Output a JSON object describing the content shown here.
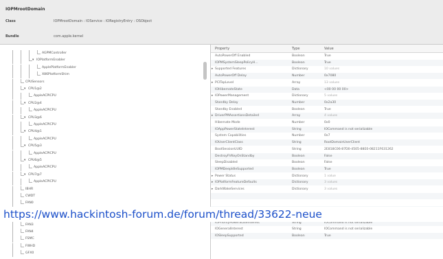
{
  "header": {
    "title": "IOPMrootDomain",
    "class_label": "Class",
    "class_value": "IOPMrootDomain : IOService : IORegistryEntry : OSObject",
    "bundle_label": "Bundle",
    "bundle_value": "com.apple.kernel"
  },
  "tree": {
    "rows": [
      {
        "label": "AGPMController",
        "indent": 4
      },
      {
        "label": "IOPlatformEnabler",
        "indent": 3,
        "expanded": true
      },
      {
        "label": "ApplePlatformEnabler",
        "indent": 4
      },
      {
        "label": "X86PlatformShim",
        "indent": 4
      },
      {
        "label": "CPUSensors",
        "indent": 2
      },
      {
        "label": "CPU1@2",
        "indent": 2,
        "expanded": true
      },
      {
        "label": "AppleACPICPU",
        "indent": 3
      },
      {
        "label": "CPU2@4",
        "indent": 2,
        "expanded": true
      },
      {
        "label": "AppleACPICPU",
        "indent": 3
      },
      {
        "label": "CPU3@6",
        "indent": 2,
        "expanded": true
      },
      {
        "label": "AppleACPICPU",
        "indent": 3
      },
      {
        "label": "CPU4@1",
        "indent": 2,
        "expanded": true
      },
      {
        "label": "AppleACPICPU",
        "indent": 3
      },
      {
        "label": "CPU5@3",
        "indent": 2,
        "expanded": true
      },
      {
        "label": "AppleACPICPU",
        "indent": 3
      },
      {
        "label": "CPU6@5",
        "indent": 2,
        "expanded": true
      },
      {
        "label": "AppleACPICPU",
        "indent": 3
      },
      {
        "label": "CPU7@7",
        "indent": 2,
        "expanded": true
      },
      {
        "label": "AppleACPICPU",
        "indent": 3
      },
      {
        "label": "IBHR",
        "indent": 2
      },
      {
        "label": "CWDT",
        "indent": 2
      },
      {
        "label": "FAN0",
        "indent": 2
      },
      {
        "label": "FAN1",
        "indent": 2
      },
      {
        "label": "FAN2",
        "indent": 2
      },
      {
        "label": "FAN3",
        "indent": 2
      },
      {
        "label": "FAN4",
        "indent": 2
      },
      {
        "label": "FSMC",
        "indent": 2
      },
      {
        "label": "FWHD",
        "indent": 2
      },
      {
        "label": "GFX0",
        "indent": 2
      }
    ]
  },
  "props": {
    "columns": [
      "Property",
      "Type",
      "Value"
    ],
    "rows": [
      {
        "key": "AutoPowerOff Enabled",
        "type": "Boolean",
        "value": "True"
      },
      {
        "key": "IOPMSystemSleepPolicyH...",
        "type": "Boolean",
        "value": "True"
      },
      {
        "key": "Supported Features",
        "type": "Dictionary",
        "value": "10 values",
        "expandable": true,
        "muted": true
      },
      {
        "key": "AutoPowerOff Delay",
        "type": "Number",
        "value": "0x7080"
      },
      {
        "key": "PCITopLevel",
        "type": "Array",
        "value": "13 values",
        "expandable": true,
        "muted": true
      },
      {
        "key": "IOHibernateState",
        "type": "Data",
        "value": "<00 00 00 00>"
      },
      {
        "key": "IOPowerManagement",
        "type": "Dictionary",
        "value": "5 values",
        "expandable": true,
        "muted": true
      },
      {
        "key": "Standby Delay",
        "type": "Number",
        "value": "0x2a30"
      },
      {
        "key": "Standby Enabled",
        "type": "Boolean",
        "value": "True"
      },
      {
        "key": "DriverPMAssertionsDetailed",
        "type": "Array",
        "value": "4 values",
        "expandable": true,
        "muted": true
      },
      {
        "key": "Hibernate Mode",
        "type": "Number",
        "value": "0x0"
      },
      {
        "key": "IOAppPowerStateInterest",
        "type": "String",
        "value": "IOCommand is not serializable"
      },
      {
        "key": "System Capabilities",
        "type": "Number",
        "value": "0x7"
      },
      {
        "key": "IOUserClientClass",
        "type": "String",
        "value": "RootDomainUserClient"
      },
      {
        "key": "BootSessionUUID",
        "type": "String",
        "value": "2E818C06-87D0-4505-88E0-08211F631262"
      },
      {
        "key": "DestroyFVKeyOnStandby",
        "type": "Boolean",
        "value": "False"
      },
      {
        "key": "SleepDisabled",
        "type": "Boolean",
        "value": "False"
      },
      {
        "key": "IOPMDeepIdleSupported",
        "type": "Boolean",
        "value": "True"
      },
      {
        "key": "Power Status",
        "type": "Dictionary",
        "value": "1 value",
        "expandable": true,
        "muted": true
      },
      {
        "key": "IOPlatformFeatureDefaults",
        "type": "Dictionary",
        "value": "3 values",
        "expandable": true,
        "muted": true
      },
      {
        "key": "DarkWakeServices",
        "type": "Dictionary",
        "value": "3 values",
        "expandable": true,
        "muted": true
      },
      {
        "key": "",
        "type": "",
        "value": ""
      },
      {
        "key": "",
        "type": "",
        "value": ""
      },
      {
        "key": "Hibernate File Min",
        "type": "Number",
        "value": "0x80000000"
      },
      {
        "key": "IOPMUserIsActive",
        "type": "Boolean",
        "value": "True"
      },
      {
        "key": "IOPriorityPowerStateInterest",
        "type": "String",
        "value": "IOCommand is not serializable"
      },
      {
        "key": "IOGeneralInterest",
        "type": "String",
        "value": "IOCommand is not serializable"
      },
      {
        "key": "IOSleepSupported",
        "type": "Boolean",
        "value": "True"
      }
    ]
  },
  "watermark": {
    "url": "https://www.hackintosh-forum.de/forum/thread/33622-neue"
  }
}
